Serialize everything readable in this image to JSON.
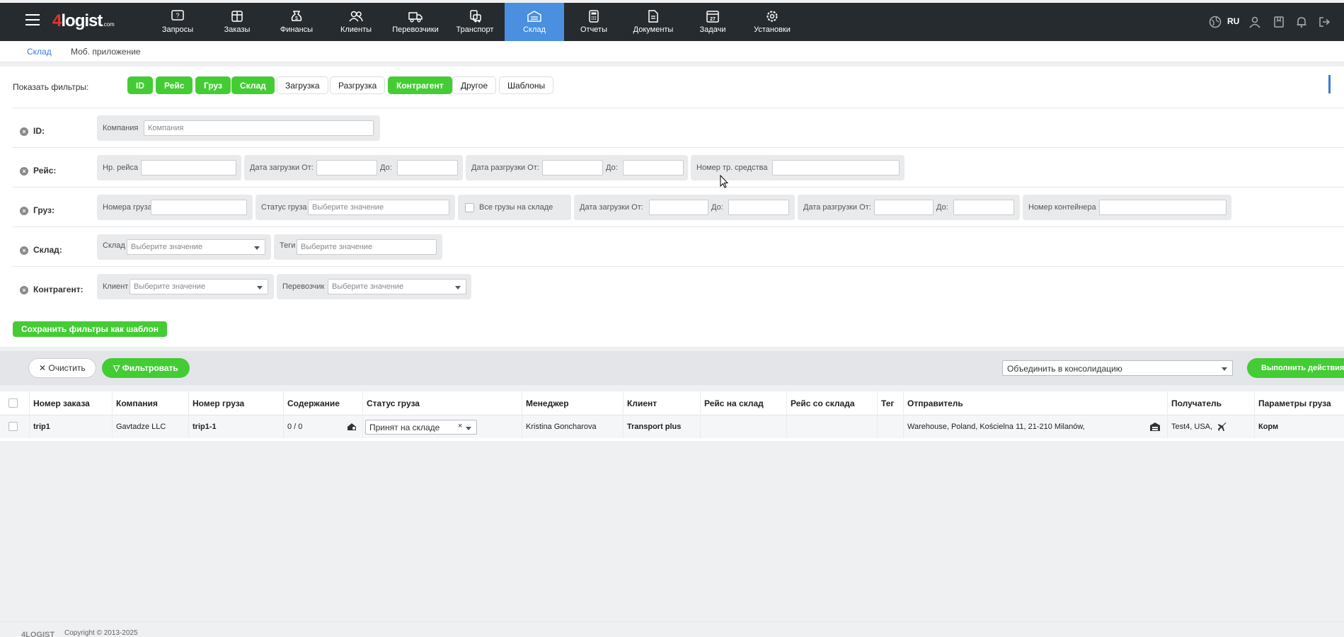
{
  "brand": {
    "logo_prefix": "4",
    "logo_name": "logist",
    "logo_suffix": ".com"
  },
  "nav": [
    {
      "label": "Запросы",
      "icon": "requests-icon"
    },
    {
      "label": "Заказы",
      "icon": "orders-icon"
    },
    {
      "label": "Финансы",
      "icon": "finance-icon"
    },
    {
      "label": "Клиенты",
      "icon": "clients-icon"
    },
    {
      "label": "Перевозчики",
      "icon": "carriers-icon"
    },
    {
      "label": "Транспорт",
      "icon": "transport-icon"
    },
    {
      "label": "Склад",
      "icon": "warehouse-icon",
      "active": true
    },
    {
      "label": "Отчеты",
      "icon": "reports-icon"
    },
    {
      "label": "Документы",
      "icon": "documents-icon"
    },
    {
      "label": "Задачи",
      "icon": "tasks-icon"
    },
    {
      "label": "Установки",
      "icon": "settings-icon"
    }
  ],
  "header_right": {
    "lang": "RU"
  },
  "subtabs": [
    {
      "label": "Склад",
      "active": true
    },
    {
      "label": "Моб. приложение"
    }
  ],
  "filters": {
    "show_label": "Показать фильтры:",
    "buttons": [
      {
        "label": "ID",
        "on": true
      },
      {
        "label": "Рейс",
        "on": true
      },
      {
        "label": "Груз",
        "on": true
      },
      {
        "label": "Склад",
        "on": true
      },
      {
        "label": "Загрузка",
        "on": false
      },
      {
        "label": "Разгрузка",
        "on": false
      },
      {
        "label": "Контрагент",
        "on": true
      },
      {
        "label": "Другое",
        "on": false
      },
      {
        "label": "Шаблоны",
        "on": false
      }
    ],
    "rows": {
      "id": {
        "label": "ID:",
        "company_label": "Компания",
        "company_placeholder": "Компания"
      },
      "trip": {
        "label": "Рейс:",
        "trip_no": "Нр. рейса",
        "load_from": "Дата загрузки От:",
        "to": "До:",
        "unload_from": "Дата разгрузки От:",
        "vehicle_no": "Номер тр. средства"
      },
      "cargo": {
        "label": "Груз:",
        "cargo_no": "Номера груза",
        "status_label": "Статус груза",
        "status_placeholder": "Выберите значение",
        "all_in_wh": "Все грузы на складе",
        "load_from": "Дата загрузки От:",
        "to": "До:",
        "unload_from": "Дата разгрузки От:",
        "container_no": "Номер контейнера"
      },
      "wh": {
        "label": "Склад:",
        "wh_label": "Склад",
        "wh_placeholder": "Выберите значение",
        "tags_label": "Теги",
        "tags_placeholder": "Выберите значение"
      },
      "cp": {
        "label": "Контрагент:",
        "client_label": "Клиент",
        "client_placeholder": "Выберите значение",
        "carrier_label": "Перевозчик",
        "carrier_placeholder": "Выберите значение"
      }
    },
    "save_template": "Сохранить фильтры как шаблон"
  },
  "actions": {
    "clear": "Очистить",
    "filter": "Фильтровать",
    "consolidation": "Объединить в консолидацию",
    "execute": "Выполнить действия"
  },
  "table": {
    "columns": [
      "Номер заказа",
      "Компания",
      "Номер груза",
      "Содержание",
      "Статус груза",
      "Менеджер",
      "Клиент",
      "Рейс на склад",
      "Рейс со склада",
      "Тег",
      "Отправитель",
      "Получатель",
      "Параметры груза"
    ],
    "rows": [
      {
        "order_no": "trip1",
        "company": "Gavtadze LLC",
        "cargo_no": "trip1-1",
        "content": "0 / 0",
        "status": "Принят на складе",
        "manager": "Kristina Goncharova",
        "client": "Transport plus",
        "trip_in": "",
        "trip_out": "",
        "tag": "",
        "sender": "Warehouse, Poland, Kościelna 11, 21-210 Milanów,",
        "receiver": "Test4, USA,",
        "params": "Корм"
      }
    ]
  },
  "footer": {
    "logo": "4LOGIST",
    "copyright": "Copyright © 2013-2025"
  }
}
